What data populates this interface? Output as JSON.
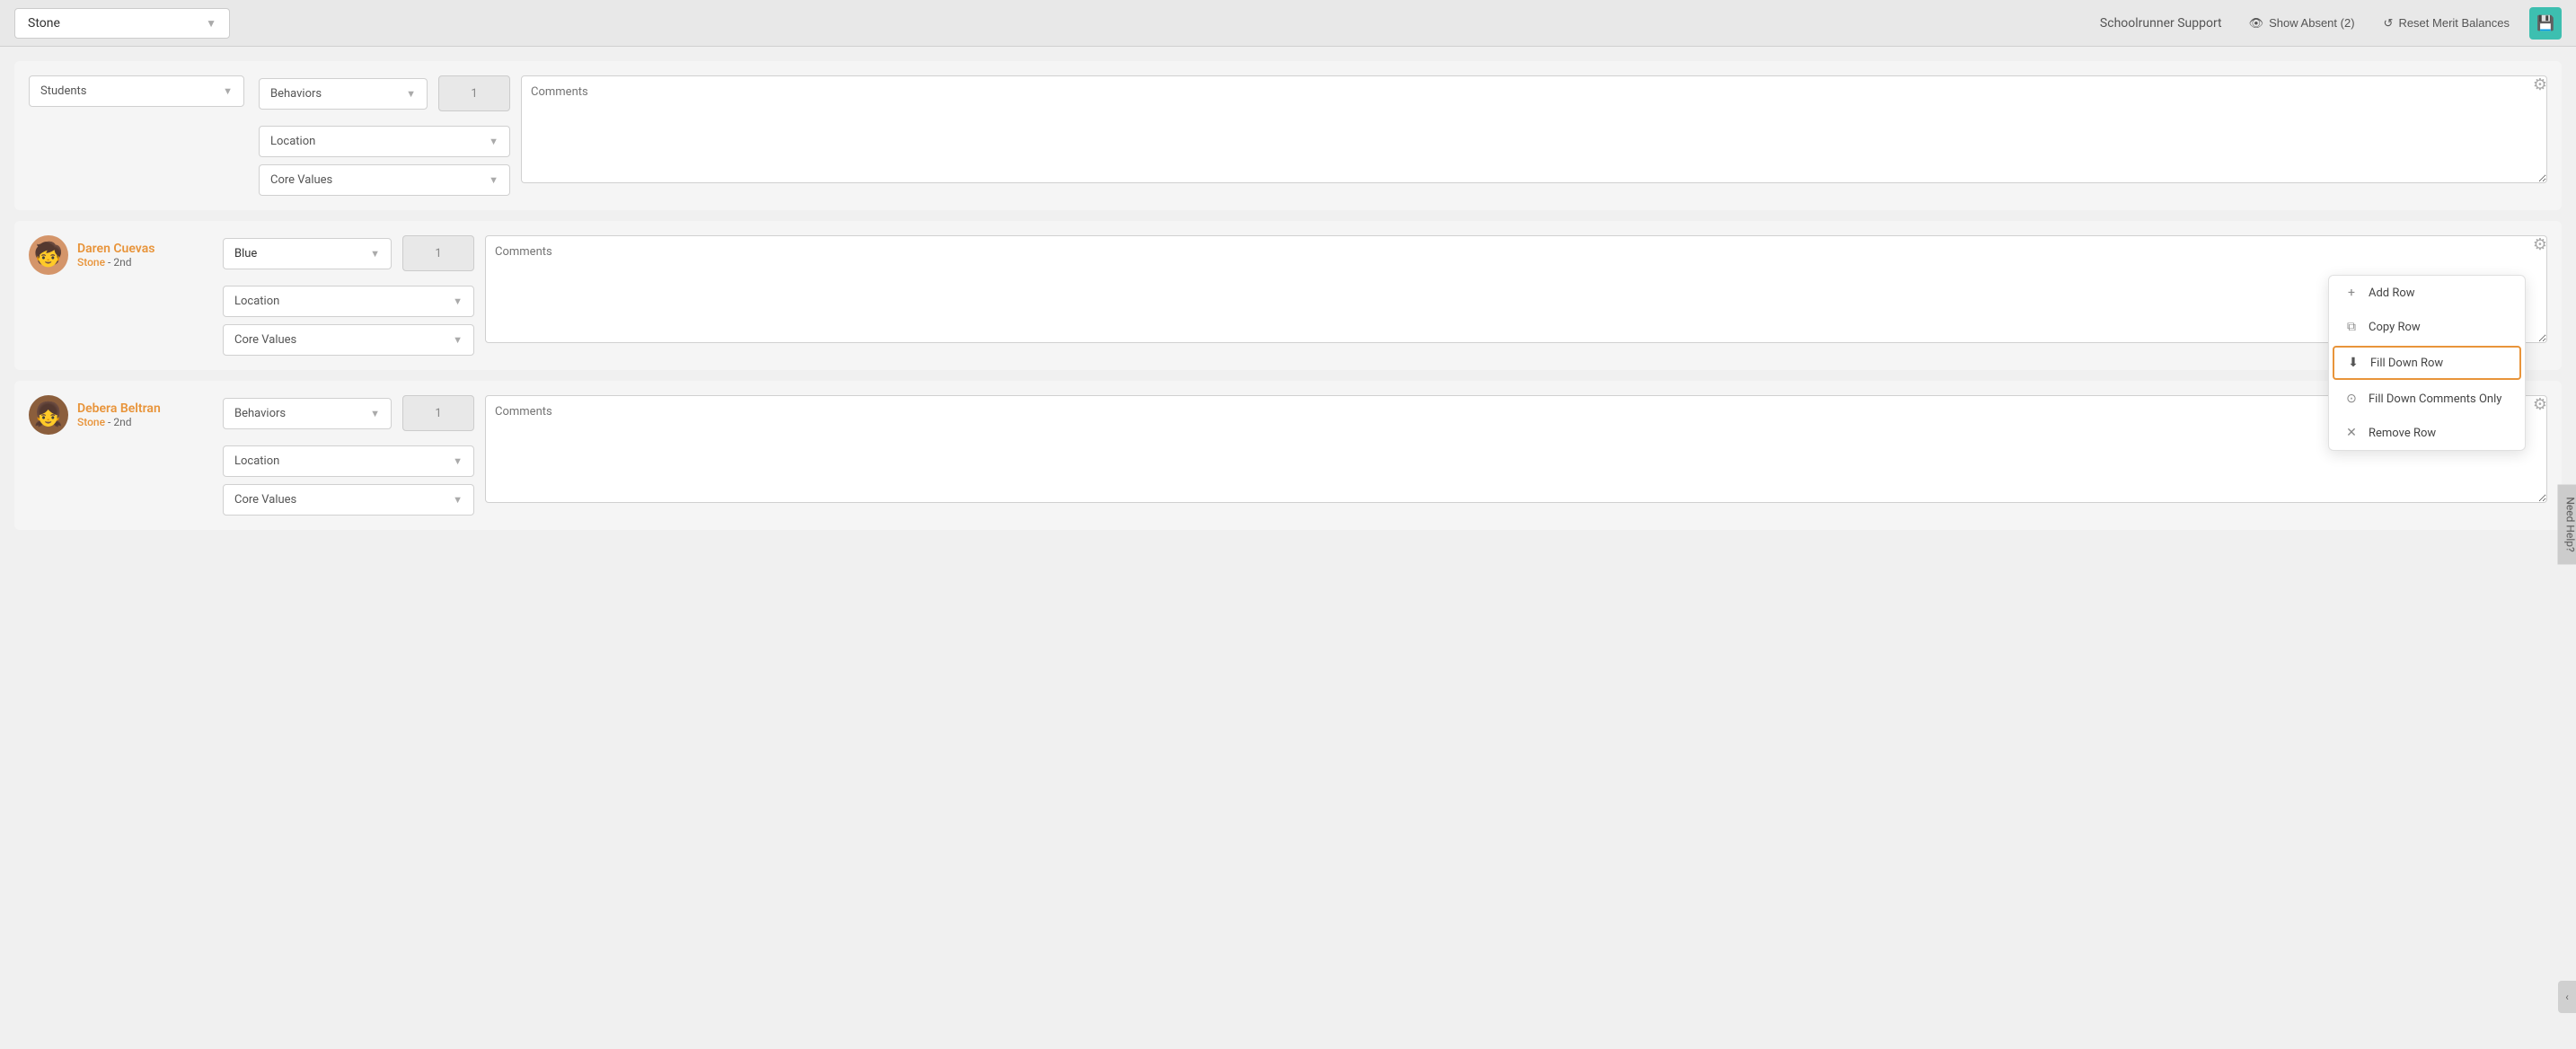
{
  "topbar": {
    "stone_label": "Stone",
    "support_label": "Schoolrunner Support",
    "show_absent_label": "Show Absent (2)",
    "reset_merit_label": "Reset Merit Balances",
    "icon_eye": "👁",
    "icon_reset": "↺",
    "icon_save": "💾"
  },
  "sections": [
    {
      "id": "section1",
      "student": null,
      "fields": {
        "students_placeholder": "Students",
        "behaviors_placeholder": "Behaviors",
        "location_placeholder": "Location",
        "core_values_placeholder": "Core Values",
        "number_value": "1",
        "comments_placeholder": "Comments"
      }
    },
    {
      "id": "section2",
      "student": {
        "name": "Daren Cuevas",
        "class": "Stone",
        "grade": "2nd",
        "avatar_color": "#d4956a",
        "avatar_emoji": "🧒"
      },
      "fields": {
        "behavior_value": "Blue",
        "location_placeholder": "Location",
        "core_values_placeholder": "Core Values",
        "number_value": "1",
        "comments_placeholder": "Comments"
      },
      "has_context_menu": true
    },
    {
      "id": "section3",
      "student": {
        "name": "Debera Beltran",
        "class": "Stone",
        "grade": "2nd",
        "avatar_color": "#8B4513",
        "avatar_emoji": "👧"
      },
      "fields": {
        "behaviors_placeholder": "Behaviors",
        "location_placeholder": "Location",
        "core_values_placeholder": "Core Values",
        "number_value": "1",
        "comments_placeholder": "Comments"
      }
    }
  ],
  "context_menu": {
    "items": [
      {
        "id": "add-row",
        "label": "Add Row",
        "icon": "+"
      },
      {
        "id": "copy-row",
        "label": "Copy Row",
        "icon": "⧉"
      },
      {
        "id": "fill-down-row",
        "label": "Fill Down Row",
        "icon": "⬇",
        "highlighted": true
      },
      {
        "id": "fill-down-comments",
        "label": "Fill Down Comments Only",
        "icon": "⊙"
      },
      {
        "id": "remove-row",
        "label": "Remove Row",
        "icon": "✕"
      }
    ]
  },
  "need_help": {
    "label": "Need Help?"
  }
}
